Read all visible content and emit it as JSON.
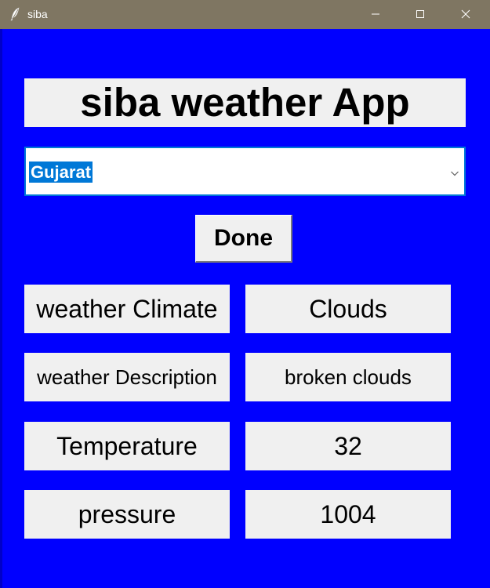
{
  "window": {
    "title": "siba",
    "icon": "feather-icon",
    "controls": [
      "minimize-icon",
      "maximize-icon",
      "close-icon"
    ],
    "background_color": "#0000ff",
    "titlebar_color": "#7f7662"
  },
  "app": {
    "heading": "siba weather App",
    "location_select": {
      "selected": "Gujarat"
    },
    "done_label": "Done",
    "fields": [
      {
        "label": "weather Climate",
        "value": "Clouds"
      },
      {
        "label": "weather Description",
        "value": "broken clouds"
      },
      {
        "label": "Temperature",
        "value": "32"
      },
      {
        "label": "pressure",
        "value": "1004"
      }
    ]
  }
}
